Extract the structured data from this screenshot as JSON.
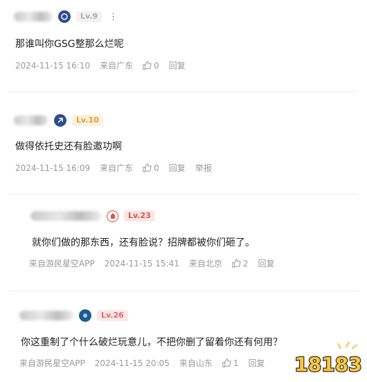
{
  "comments": [
    {
      "lv": "Lv.9",
      "text": "那谁叫你GSG整那么烂呢",
      "date": "2024-11-15 16:10",
      "loc": "来自广东",
      "likes": "0",
      "reply": "回复",
      "report": ""
    },
    {
      "lv": "Lv.10",
      "text": "做得依托史还有脸邀功啊",
      "date": "2024-11-15 16:09",
      "loc": "来自广东",
      "likes": "0",
      "reply": "回复",
      "report": "举报"
    },
    {
      "lv": "Lv.23",
      "text": "就你们做的那东西，还有脸说？招牌都被你们砸了。",
      "src": "来自游民星空APP",
      "date": "2024-11-15 15:41",
      "loc": "来自北京",
      "likes": "2",
      "reply": "回复"
    },
    {
      "lv": "Lv.26",
      "text": "你这重制了个什么破烂玩意儿，不把你删了留着你还有何用？",
      "src": "来自游民星空APP",
      "date": "2024-11-15 20:05",
      "loc": "来自山东",
      "likes": "1",
      "reply": "回复"
    }
  ],
  "more_label": "⋮",
  "logo_text": "18183",
  "colors": {
    "lv_gray": "#aaaaaa",
    "lv_orange": "#f0a23c",
    "lv_red": "#e06666"
  }
}
